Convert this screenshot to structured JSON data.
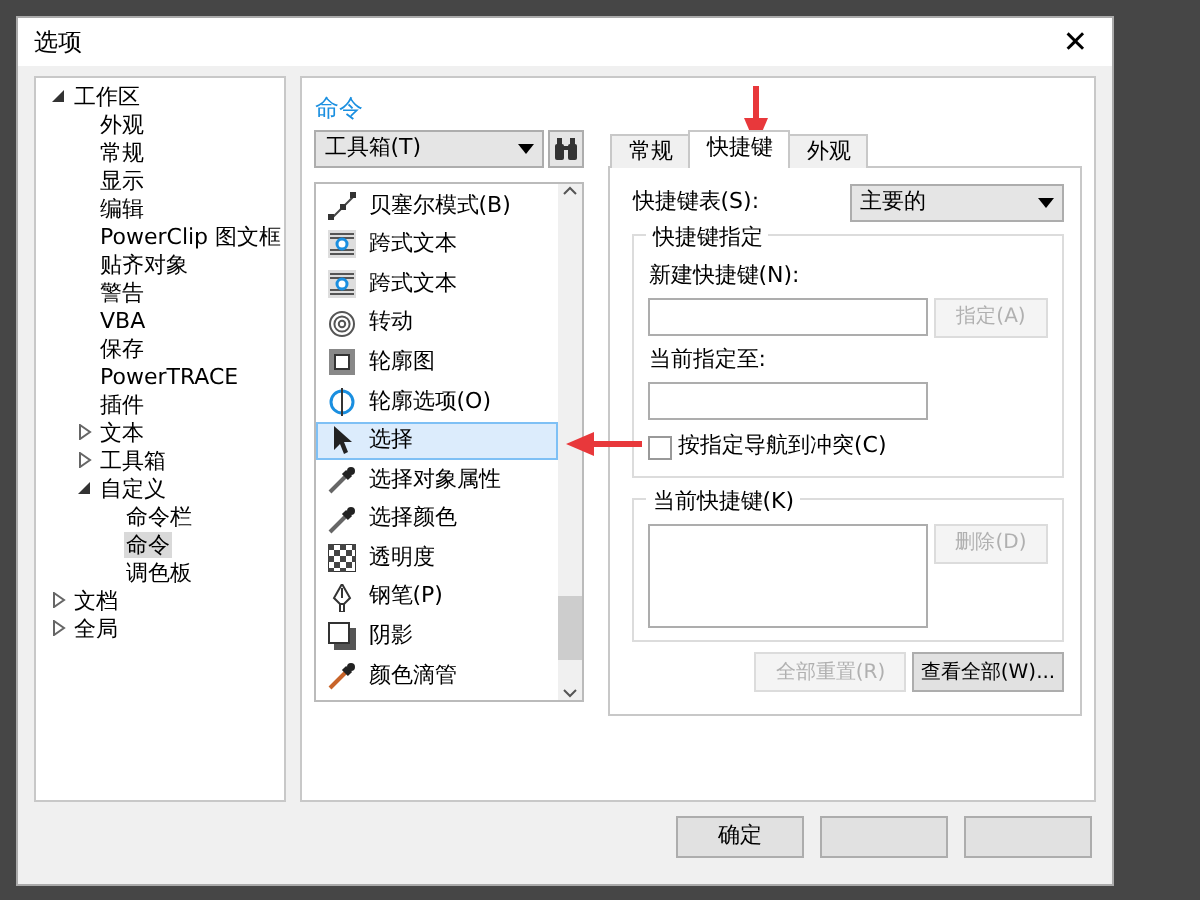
{
  "window": {
    "title": "选项",
    "close": "✕"
  },
  "tree": [
    {
      "label": "工作区",
      "expanded": true,
      "selected": false,
      "children": [
        {
          "label": "外观",
          "selected": false
        },
        {
          "label": "常规",
          "selected": false
        },
        {
          "label": "显示",
          "selected": false
        },
        {
          "label": "编辑",
          "selected": false
        },
        {
          "label": "PowerClip 图文框",
          "selected": false
        },
        {
          "label": "贴齐对象",
          "selected": false
        },
        {
          "label": "警告",
          "selected": false
        },
        {
          "label": "VBA",
          "selected": false
        },
        {
          "label": "保存",
          "selected": false
        },
        {
          "label": "PowerTRACE",
          "selected": false
        },
        {
          "label": "插件",
          "selected": false
        },
        {
          "label": "文本",
          "expanded": false,
          "selected": false
        },
        {
          "label": "工具箱",
          "expanded": false,
          "selected": false
        },
        {
          "label": "自定义",
          "expanded": true,
          "selected": false,
          "children": [
            {
              "label": "命令栏",
              "selected": false
            },
            {
              "label": "命令",
              "selected": true
            },
            {
              "label": "调色板",
              "selected": false
            }
          ]
        }
      ]
    },
    {
      "label": "文档",
      "expanded": false,
      "selected": false
    },
    {
      "label": "全局",
      "expanded": false,
      "selected": false
    }
  ],
  "panel": {
    "heading": "命令",
    "category": "工具箱(T)",
    "commands": [
      {
        "label": "贝塞尔模式(B)",
        "kind": "curve",
        "selected": false
      },
      {
        "label": "跨式文本",
        "kind": "textframe",
        "selected": false
      },
      {
        "label": "跨式文本",
        "kind": "textframe",
        "selected": false
      },
      {
        "label": "转动",
        "kind": "spiral",
        "selected": false
      },
      {
        "label": "轮廓图",
        "kind": "contour",
        "selected": false
      },
      {
        "label": "轮廓选项(O)",
        "kind": "outline",
        "selected": false
      },
      {
        "label": "选择",
        "kind": "pointer",
        "selected": true
      },
      {
        "label": "选择对象属性",
        "kind": "dropper",
        "selected": false
      },
      {
        "label": "选择颜色",
        "kind": "dropper",
        "selected": false
      },
      {
        "label": "透明度",
        "kind": "checker",
        "selected": false
      },
      {
        "label": "钢笔(P)",
        "kind": "pen",
        "selected": false
      },
      {
        "label": "阴影",
        "kind": "shadow",
        "selected": false
      },
      {
        "label": "颜色滴管",
        "kind": "colordropper",
        "selected": false
      }
    ]
  },
  "tabs": [
    {
      "label": "常规",
      "selected": false
    },
    {
      "label": "快捷键",
      "selected": true
    },
    {
      "label": "外观",
      "selected": false
    }
  ],
  "shortcuts": {
    "table_label": "快捷键表(S):",
    "table_value": "主要的",
    "assign_group": "快捷键指定",
    "new_label": "新建快捷键(N):",
    "assign_button": {
      "label": "指定(A)",
      "disabled": true
    },
    "current_assigned_label": "当前指定至:",
    "navigate_checkbox": {
      "label": "按指定导航到冲突(C)",
      "checked": false
    },
    "current_group": "当前快捷键(K)",
    "delete_button": {
      "label": "删除(D)",
      "disabled": true
    },
    "reset_button": {
      "label": "全部重置(R)",
      "disabled": true
    },
    "view_all_button": {
      "label": "查看全部(W)...",
      "disabled": false
    }
  },
  "buttons": [
    {
      "label": "确定"
    }
  ]
}
